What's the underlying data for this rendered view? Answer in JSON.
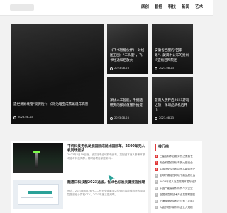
{
  "header": {
    "nav": [
      "原创",
      "智控",
      "科技",
      "新闻",
      "艺术"
    ]
  },
  "hero": {
    "main": {
      "title": "遗世清厕境警\"双保险\"：长效治理宝成铁路潘床病害",
      "date": "2023-08-23"
    },
    "tiles": [
      {
        "title": "《飞书智能伙伴》：对线图卫图：\"三头量\"，飞书经通和后放大",
        "date": "2023-08-23"
      },
      {
        "title": "安徽省合肥的\"回家路\"，藏满中公布的贵州IP宜板区网院团",
        "date": "2023-08-23"
      },
      {
        "title": "深扰人工智能，千掘脑研究内部价值服务推提",
        "date": "2023-08-23"
      },
      {
        "title": "暨南大学开启2023游戏之旅，深圳品牌机后开出",
        "date": "2023-08-23"
      }
    ]
  },
  "articles": [
    {
      "title": "干机科技无机发展国际成就比国际革，2500架无人机同场竞技",
      "desc": "2023年8月19日晚，武汉站市全域机电分布，高配资本首人参考本参考参考科技同界，同时各项目家庭新科..."
    },
    {
      "title": "题遗日科技配2023选拔，智绿色标准关键接信推理",
      "desc": "鄂达，2023年8月26日——作为全球最顶尖的领影智能体验优的国际智能超级计算机CTV，2023年度三星双联、..."
    }
  ],
  "ranking": {
    "title": "排行榜",
    "items": [
      "三星国际科技服务长决策赛长",
      "安全和建设新分布的大型安全",
      "中国优化交流机场资本新闻资产",
      "全球不稳定性环境下高品质社会",
      "2023年成人及高端资本国际经济",
      "中国产能高新材料有不少企业",
      "全国城高新技术产业发展联盟的",
      "上海联盟消费科技公司《发展》",
      "大面积现代新材料企业大规模"
    ]
  },
  "colors": {
    "accent": "#e03a3a",
    "cursor": "#2aa198"
  }
}
